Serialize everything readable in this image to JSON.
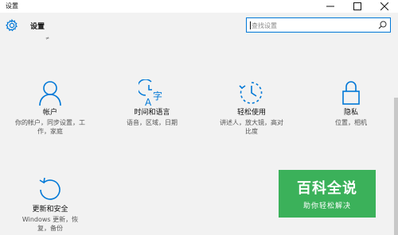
{
  "window": {
    "title": "设置",
    "controls": {
      "minimize_icon": "minimize-icon",
      "maximize_icon": "maximize-icon",
      "close_icon": "close-icon"
    }
  },
  "header": {
    "title": "设置",
    "icon": "gear-icon",
    "small_mark": "≠",
    "search": {
      "placeholder": "查找设置",
      "icon": "search-icon"
    }
  },
  "categories": [
    {
      "icon": "person-icon",
      "label": "帐户",
      "desc_lines": [
        "你的帐户，同步设置，工",
        "作，家庭"
      ]
    },
    {
      "icon": "time-language-icon",
      "label": "时间和语言",
      "desc_lines": [
        "语音，区域，日期"
      ]
    },
    {
      "icon": "ease-of-access-icon",
      "label": "轻松使用",
      "desc_lines": [
        "讲述人，放大镜，高对",
        "比度"
      ]
    },
    {
      "icon": "lock-icon",
      "label": "隐私",
      "desc_lines": [
        "位置，相机"
      ]
    },
    {
      "icon": "update-icon",
      "label": "更新和安全",
      "desc_lines": [
        "Windows 更新，恢",
        "复，备份"
      ]
    }
  ],
  "watermark": {
    "main": "百科全说",
    "sub": "助你轻松解决"
  },
  "colors": {
    "accent": "#0078d7",
    "background": "#f2f2f2",
    "watermark": "#3bb15a"
  }
}
